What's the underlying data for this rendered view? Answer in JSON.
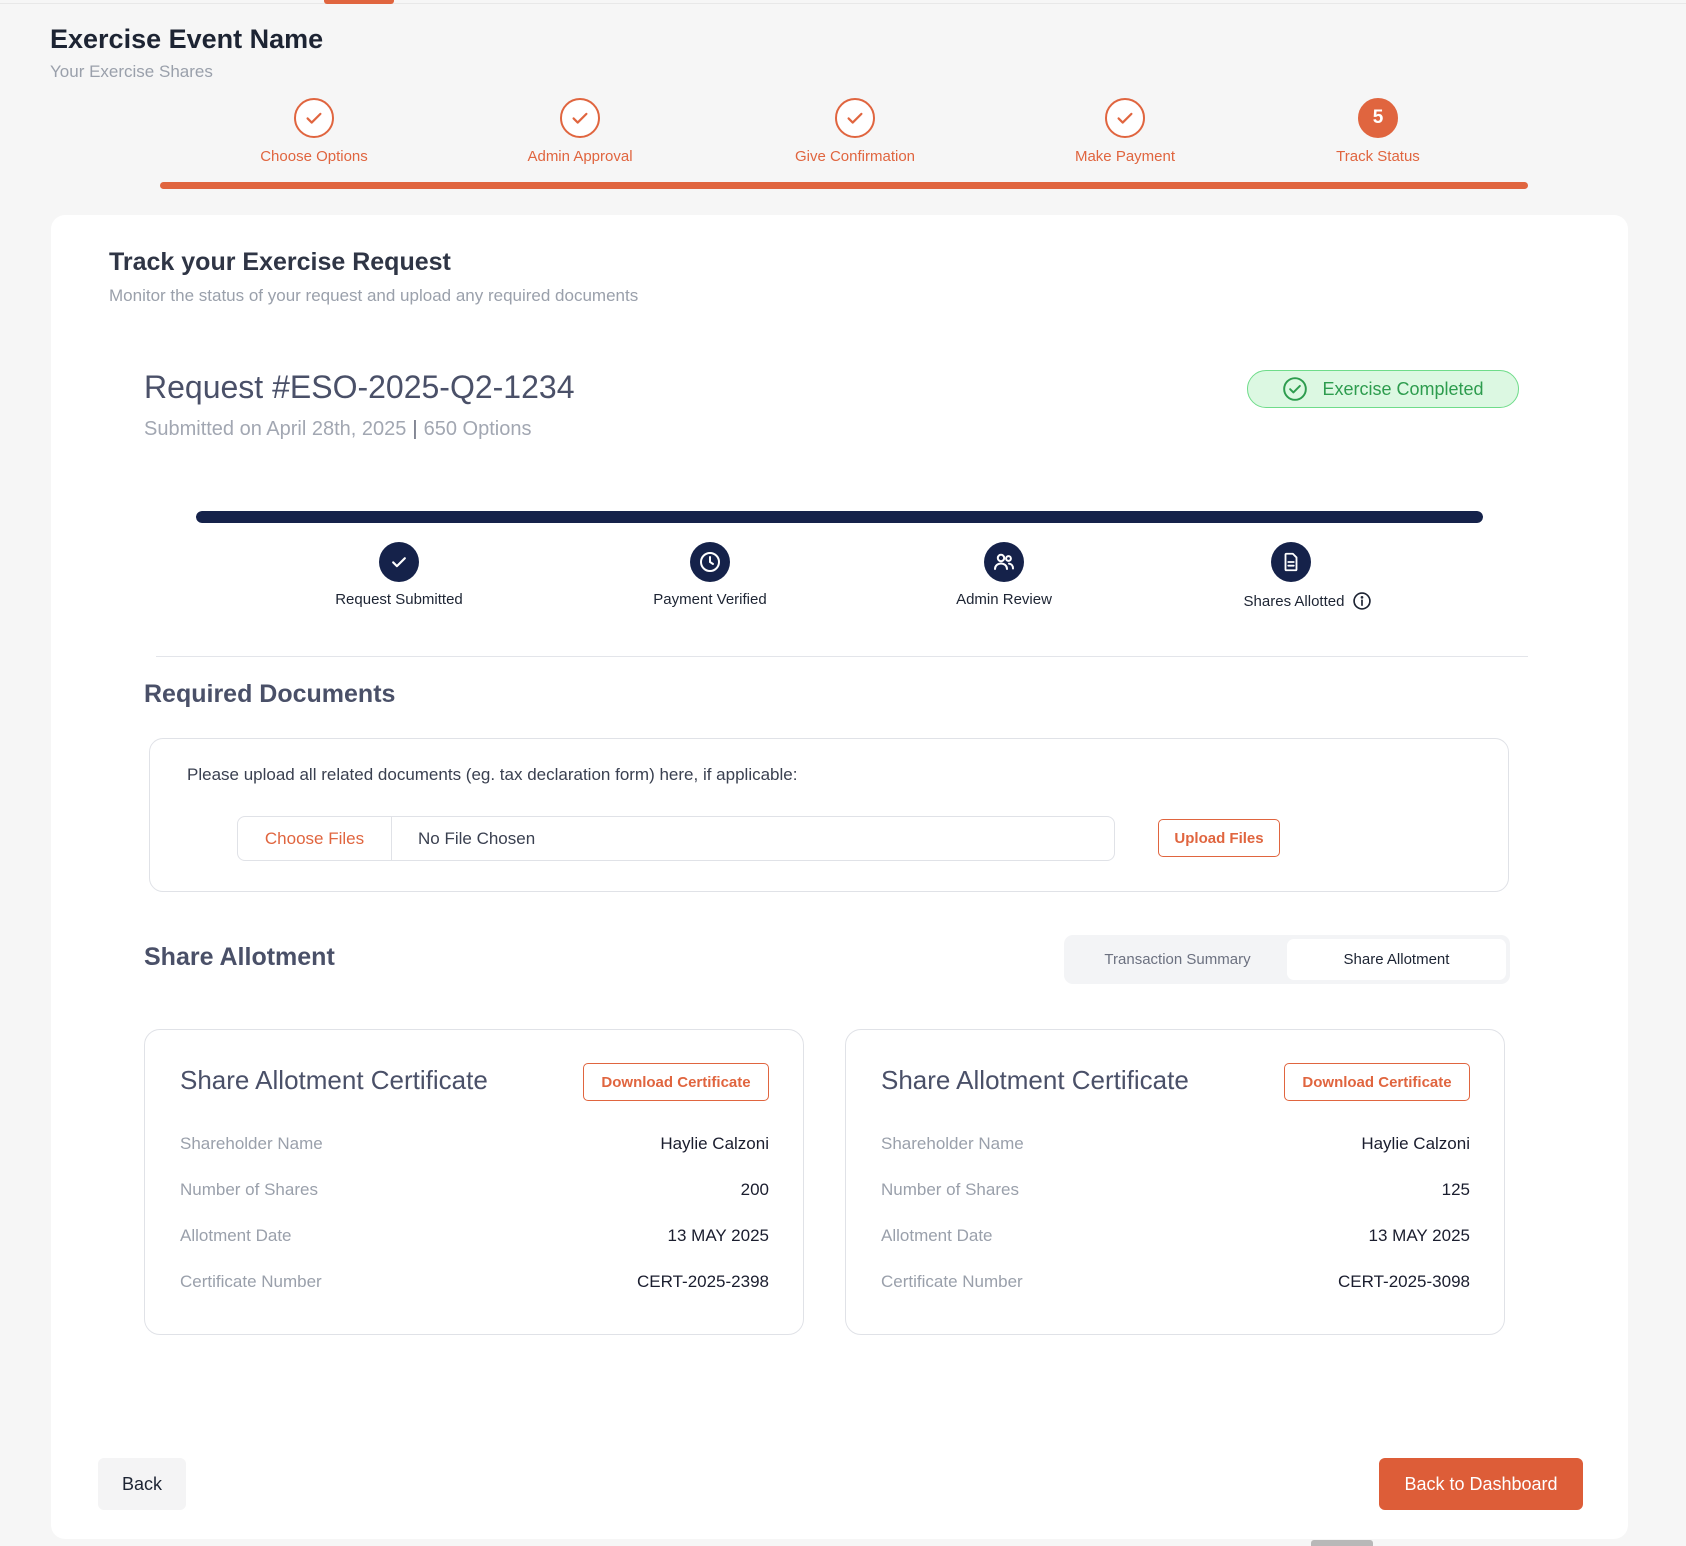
{
  "header": {
    "title": "Exercise Event Name",
    "subtitle": "Your Exercise Shares"
  },
  "wizard": {
    "accent_color": "#e0653f",
    "steps": [
      {
        "label": "Choose Options",
        "state": "done",
        "icon": "check-icon"
      },
      {
        "label": "Admin Approval",
        "state": "done",
        "icon": "check-icon"
      },
      {
        "label": "Give Confirmation",
        "state": "done",
        "icon": "check-icon"
      },
      {
        "label": "Make Payment",
        "state": "done",
        "icon": "check-icon"
      },
      {
        "label": "Track Status",
        "state": "active",
        "number": "5"
      }
    ]
  },
  "track": {
    "title": "Track your Exercise Request",
    "subtitle": "Monitor the status of your request and upload any required documents"
  },
  "request": {
    "title": "Request #ESO-2025-Q2-1234",
    "submitted": "Submitted on April 28th, 2025",
    "separator": "|",
    "options": "650 Options",
    "status": "Exercise Completed",
    "status_color": "#2d9c4e"
  },
  "progress": {
    "fraction": 1.0,
    "color": "#15224a",
    "steps": [
      {
        "label": "Request Submitted",
        "icon": "check-icon"
      },
      {
        "label": "Payment Verified",
        "icon": "clock-icon"
      },
      {
        "label": "Admin Review",
        "icon": "users-icon"
      },
      {
        "label": "Shares Allotted",
        "icon": "document-icon",
        "info_icon": "info-icon"
      }
    ]
  },
  "documents": {
    "title": "Required Documents",
    "instructions": "Please upload all related documents (eg. tax declaration form) here, if applicable:",
    "choose_label": "Choose Files",
    "file_status": "No File Chosen",
    "upload_label": "Upload Files"
  },
  "allotment": {
    "title": "Share Allotment",
    "tabs": [
      {
        "label": "Transaction Summary",
        "active": false
      },
      {
        "label": "Share Allotment",
        "active": true
      }
    ],
    "certificates": [
      {
        "title": "Share Allotment Certificate",
        "download_label": "Download Certificate",
        "rows": [
          {
            "key": "Shareholder Name",
            "value": "Haylie Calzoni"
          },
          {
            "key": "Number of Shares",
            "value": "200"
          },
          {
            "key": "Allotment Date",
            "value": "13 MAY 2025"
          },
          {
            "key": "Certificate Number",
            "value": "CERT-2025-2398"
          }
        ]
      },
      {
        "title": "Share Allotment Certificate",
        "download_label": "Download Certificate",
        "rows": [
          {
            "key": "Shareholder Name",
            "value": "Haylie Calzoni"
          },
          {
            "key": "Number of Shares",
            "value": "125"
          },
          {
            "key": "Allotment Date",
            "value": "13 MAY 2025"
          },
          {
            "key": "Certificate Number",
            "value": "CERT-2025-3098"
          }
        ]
      }
    ]
  },
  "footer": {
    "back_label": "Back",
    "dashboard_label": "Back to Dashboard"
  }
}
